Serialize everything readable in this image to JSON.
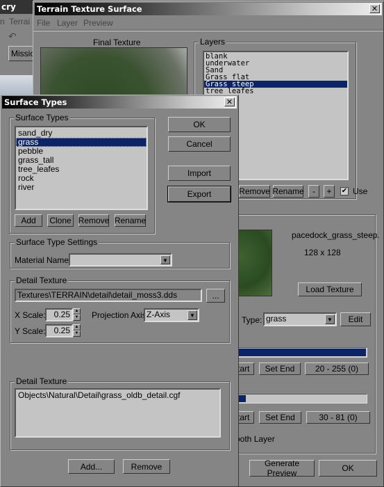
{
  "bg_app": {
    "title": "cry",
    "menu": "n  Terrai",
    "toolbar_button": "Missio"
  },
  "main": {
    "title": "Terrain Texture Surface",
    "menu": [
      "File",
      "Layer",
      "Preview"
    ],
    "final_texture_label": "Final Texture",
    "layers": {
      "label": "Layers",
      "items": [
        "blank",
        "underwater",
        "Sand",
        "Grass_flat",
        "Grass_steep",
        "tree_leafes"
      ],
      "selected": "Grass_steep",
      "remove": "Remove",
      "rename": "Rename",
      "minus": "-",
      "plus": "+",
      "use_label": "Use",
      "use_checked": true
    },
    "layer": {
      "texture_name": "pacedock_grass_steep.",
      "texture_size": "128 x 128",
      "load_texture": "Load Texture",
      "type_label": "Type:",
      "type_value": "grass",
      "edit": "Edit",
      "altitude": {
        "fill_percent": 99,
        "set_start": "Set Start",
        "set_end": "Set End",
        "range": "20 - 255 (0)"
      },
      "slope": {
        "fill_percent": 20,
        "set_start": "Set Start",
        "set_end": "Set End",
        "range": "30 - 81 (0)"
      },
      "smooth_label": "Smooth Layer"
    },
    "generate_preview": "Generate Preview",
    "ok": "OK"
  },
  "dialog": {
    "title": "Surface Types",
    "close": "X",
    "group_label": "Surface Types",
    "items": [
      "sand_dry",
      "grass",
      "pebble",
      "grass_tall",
      "tree_leafes",
      "rock",
      "river"
    ],
    "selected": "grass",
    "add": "Add",
    "clone": "Clone",
    "remove": "Remove",
    "rename": "Rename",
    "ok": "OK",
    "cancel": "Cancel",
    "import": "Import",
    "export": "Export",
    "settings": {
      "label": "Surface Type Settings",
      "material_label": "Material Name:",
      "material_value": ""
    },
    "detail": {
      "label": "Detail Texture",
      "path": "Textures\\TERRAIN\\detail\\detail_moss3.dds",
      "browse": "...",
      "x_scale_label": "X Scale:",
      "x_scale": "0.25",
      "y_scale_label": "Y Scale:",
      "y_scale": "0.25",
      "projection_label": "Projection Axis:",
      "projection_value": "Z-Axis"
    },
    "detail_objects": {
      "label": "Detail Texture",
      "items": [
        "Objects\\Natural\\Detail\\grass_oldb_detail.cgf"
      ],
      "add": "Add...",
      "remove": "Remove"
    }
  }
}
